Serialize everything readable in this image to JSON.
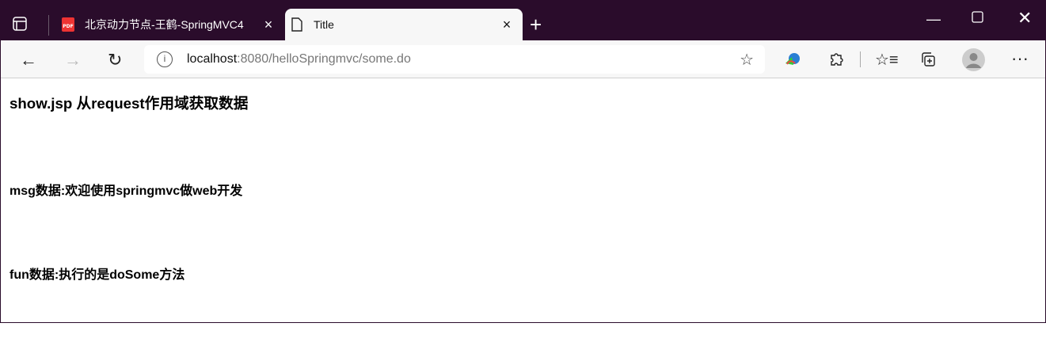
{
  "tabs": [
    {
      "label": "北京动力节点-王鹤-SpringMVC4",
      "icon": "pdf-icon"
    },
    {
      "label": "Title",
      "icon": "page-icon",
      "active": true
    }
  ],
  "address": {
    "host": "localhost",
    "rest": ":8080/helloSpringmvc/some.do"
  },
  "page": {
    "heading": "show.jsp 从request作用域获取数据",
    "msg": "msg数据:欢迎使用springmvc做web开发",
    "fun": "fun数据:执行的是doSome方法"
  },
  "colors": {
    "titlebar": "#2a0c2b",
    "toolbar": "#f7f7f7"
  }
}
